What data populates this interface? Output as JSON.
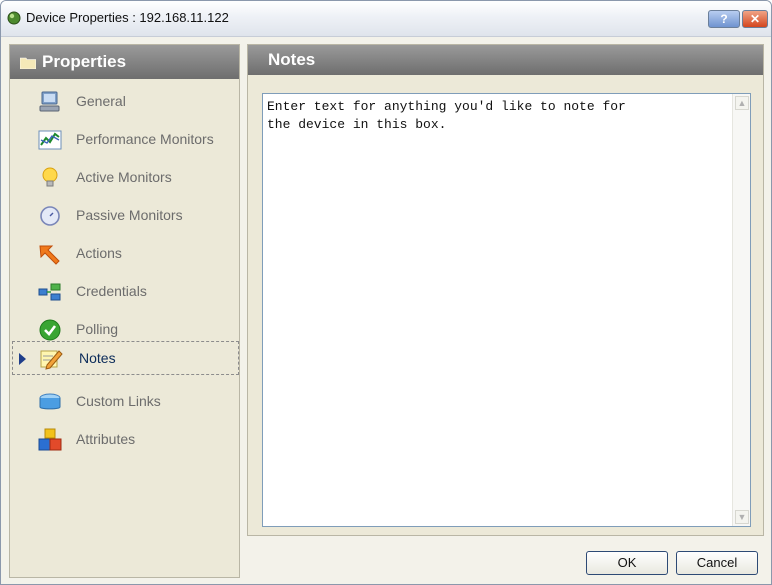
{
  "window": {
    "title": "Device Properties : 192.168.11.122",
    "help_label": "?",
    "close_label": "✕"
  },
  "sidebar": {
    "header": "Properties",
    "items": [
      {
        "label": "General",
        "icon": "computer-icon"
      },
      {
        "label": "Performance Monitors",
        "icon": "chart-icon"
      },
      {
        "label": "Active Monitors",
        "icon": "lightbulb-icon"
      },
      {
        "label": "Passive Monitors",
        "icon": "gauge-icon"
      },
      {
        "label": "Actions",
        "icon": "actions-arrow-icon"
      },
      {
        "label": "Credentials",
        "icon": "credentials-icon"
      },
      {
        "label": "Polling",
        "icon": "checkmark-icon"
      },
      {
        "label": "Notes",
        "icon": "notes-pencil-icon",
        "selected": true
      },
      {
        "label": "Custom Links",
        "icon": "links-icon"
      },
      {
        "label": "Attributes",
        "icon": "attributes-blocks-icon"
      }
    ]
  },
  "main": {
    "header": "Notes",
    "notes_text": "Enter text for anything you'd like to note for\nthe device in this box."
  },
  "footer": {
    "ok_label": "OK",
    "cancel_label": "Cancel"
  }
}
